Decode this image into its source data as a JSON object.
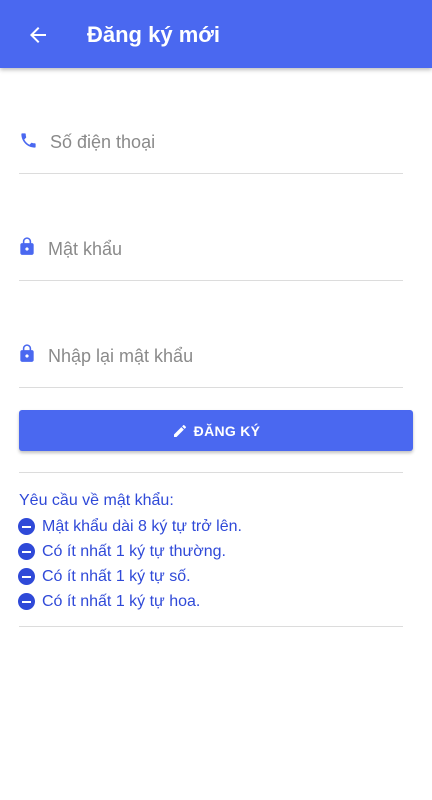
{
  "header": {
    "title": "Đăng ký mới",
    "back_icon": "arrow-back-icon",
    "background": "#4a68f0"
  },
  "form": {
    "phone": {
      "placeholder": "Số điện thoại",
      "icon": "phone-icon"
    },
    "password": {
      "placeholder": "Mật khẩu",
      "icon": "lock-icon"
    },
    "confirm_password": {
      "placeholder": "Nhập lại mật khẩu",
      "icon": "lock-icon"
    },
    "submit": {
      "label": "ĐĂNG KÝ",
      "icon": "pencil-icon"
    }
  },
  "requirements": {
    "title": "Yêu cầu về mật khẩu:",
    "items": [
      "Mật khẩu dài 8 ký tự trở lên.",
      "Có ít nhất 1 ký tự thường.",
      "Có ít nhất 1 ký tự số.",
      "Có ít nhất 1 ký tự hoa."
    ],
    "color": "#2f49d8"
  }
}
